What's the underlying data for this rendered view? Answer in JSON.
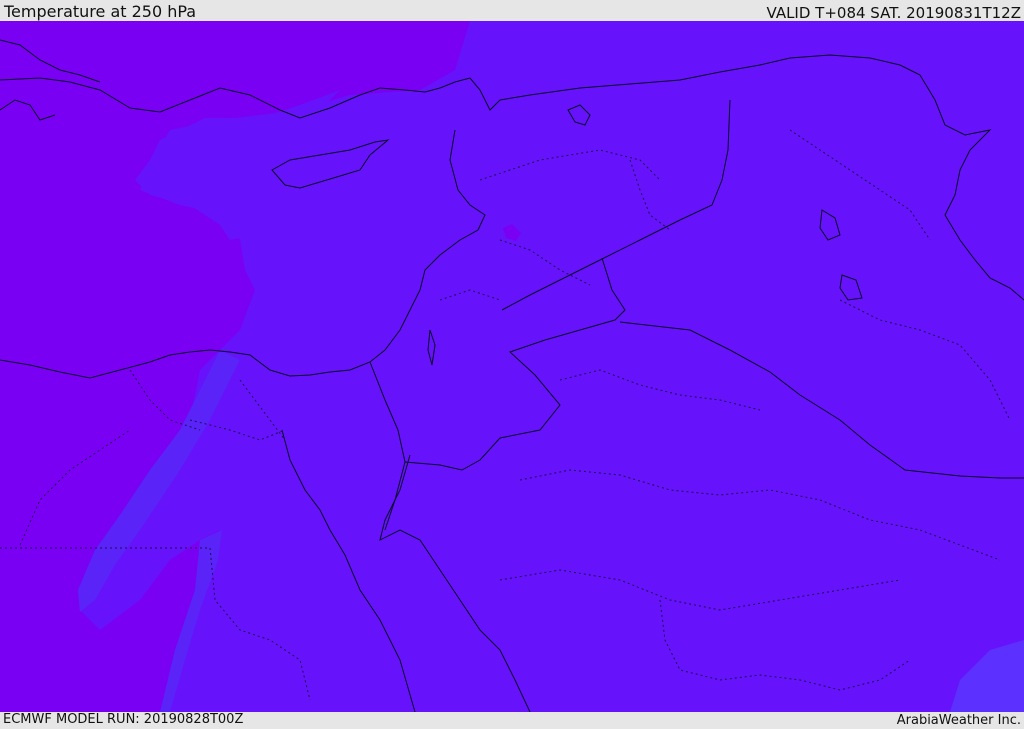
{
  "header": {
    "title": "Temperature at 250 hPa",
    "valid": "VALID T+084 SAT. 20190831T12Z"
  },
  "footer": {
    "model_run": "ECMWF MODEL RUN: 20190828T00Z",
    "credit": "ArabiaWeather Inc."
  },
  "colors": {
    "cold_purple": "#7a00f4",
    "mid_violet": "#6612fa",
    "blue_violet": "#5a23f8",
    "pale_violet": "#6a2aff",
    "border": "#0a0a2a"
  }
}
